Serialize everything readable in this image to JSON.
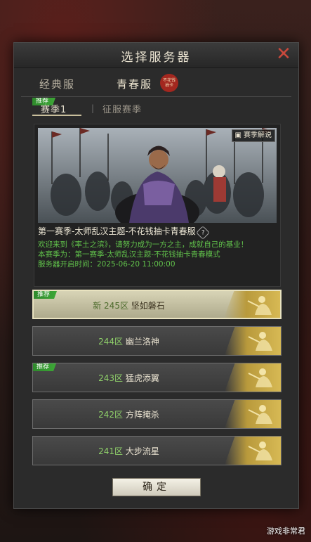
{
  "dialog": {
    "title": "选择服务器",
    "close_icon": "close-icon"
  },
  "tabs": [
    {
      "label": "经典服",
      "active": false
    },
    {
      "label": "青春服",
      "active": true,
      "seal_text": "不花钱抽卡"
    }
  ],
  "subtabs": [
    {
      "label": "赛季1",
      "active": true,
      "badge": "推荐"
    },
    {
      "label": "征服赛季",
      "active": false
    }
  ],
  "banner": {
    "guide_button": "赛季解说",
    "season_title": "第一赛季-太师乱汉主题-不花钱抽卡青春服",
    "help_icon": "?",
    "desc_lines": [
      "欢迎来到《率土之滨》，请努力成为一方之主，成就自己的基业！",
      "本赛季为：第一赛季-太师乱汉主题-不花钱抽卡青春模式",
      "服务器开启时间：2025-06-20 11:00:00"
    ]
  },
  "servers": [
    {
      "badge": "推荐",
      "prefix": "新",
      "zone": "245区",
      "name": "坚如磐石",
      "selected": true
    },
    {
      "badge": "",
      "prefix": "",
      "zone": "244区",
      "name": "幽兰洛神",
      "selected": false
    },
    {
      "badge": "推荐",
      "prefix": "",
      "zone": "243区",
      "name": "猛虎添翼",
      "selected": false
    },
    {
      "badge": "",
      "prefix": "",
      "zone": "242区",
      "name": "方阵掩杀",
      "selected": false
    },
    {
      "badge": "",
      "prefix": "",
      "zone": "241区",
      "name": "大步流星",
      "selected": false
    }
  ],
  "confirm_label": "确定",
  "watermark": "游戏非常君",
  "colors": {
    "accent_green": "#61c24b",
    "close_red": "#c9493c",
    "selected_gold": "#d7b954"
  }
}
